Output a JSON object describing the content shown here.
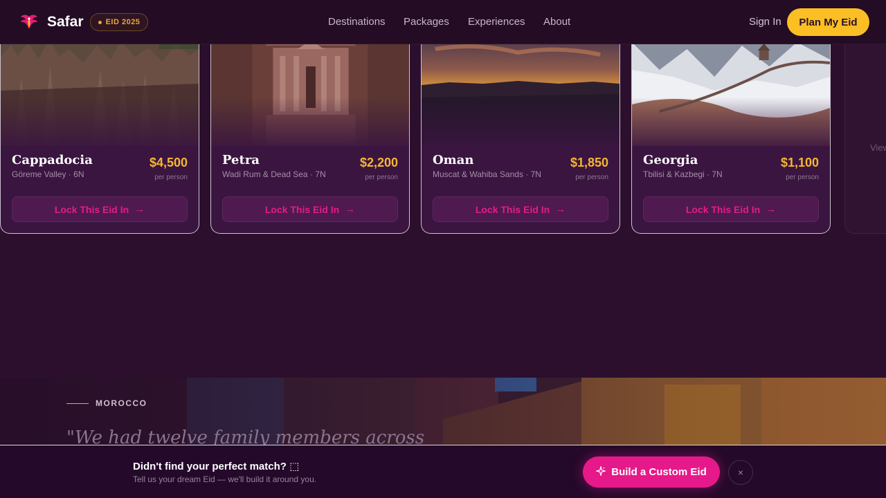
{
  "header": {
    "brand": "Safar",
    "badge": "EID 2025",
    "nav": [
      "Destinations",
      "Packages",
      "Experiences",
      "About"
    ],
    "sign_in": "Sign In",
    "cta": "Plan My Eid"
  },
  "cards": [
    {
      "title": "Cappadocia",
      "subtitle": "Göreme Valley · 6N",
      "price": "$4,500",
      "per": "per person",
      "button": "Lock This Eid In"
    },
    {
      "title": "Petra",
      "subtitle": "Wadi Rum & Dead Sea · 7N",
      "price": "$2,200",
      "per": "per person",
      "button": "Lock This Eid In"
    },
    {
      "title": "Oman",
      "subtitle": "Muscat & Wahiba Sands · 7N",
      "price": "$1,850",
      "per": "per person",
      "button": "Lock This Eid In"
    },
    {
      "title": "Georgia",
      "subtitle": "Tbilisi & Kazbegi · 7N",
      "price": "$1,100",
      "per": "per person",
      "button": "Lock This Eid In"
    }
  ],
  "ghost_card": {
    "text": "View"
  },
  "testimonial": {
    "country": "MOROCCO",
    "quote": "\"We had twelve family members across"
  },
  "bottom_bar": {
    "title": "Didn't find your perfect match? ⬚",
    "subtitle": "Tell us your dream Eid — we'll build it around you.",
    "button": "Build a Custom Eid",
    "close": "×"
  },
  "colors": {
    "accent_gold": "#fbbf24",
    "accent_pink": "#e6198a",
    "background": "#2b0f2c"
  },
  "icons": [
    "phoenix-logo-icon",
    "arrow-right-icon",
    "sparkle-icon",
    "close-icon"
  ]
}
